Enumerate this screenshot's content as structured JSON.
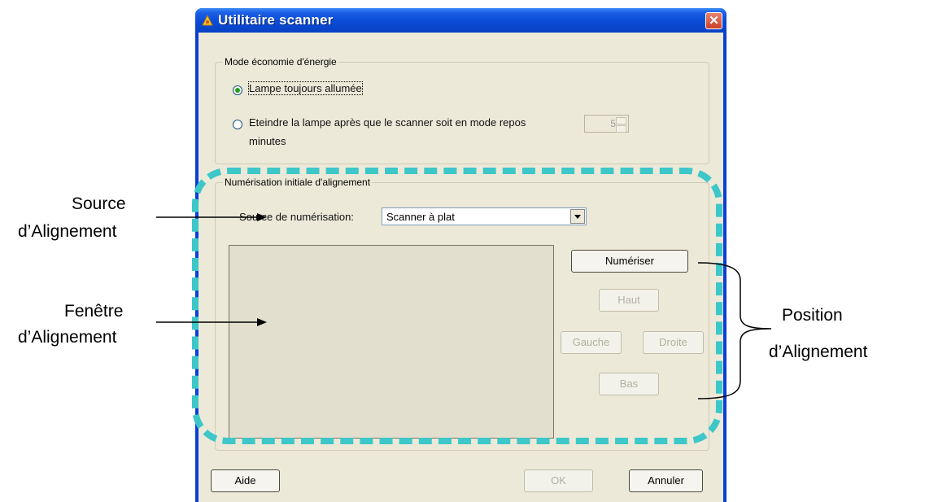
{
  "window": {
    "title": "Utilitaire scanner"
  },
  "power_group": {
    "label": "Mode économie d'énergie",
    "option_always_on": "Lampe toujours allumée",
    "option_turn_off": "Eteindre la lampe après que le scanner soit en mode repos",
    "option_turn_off_unit": "minutes",
    "repos_minutes": "5",
    "selected": "option_always_on"
  },
  "align_group": {
    "label": "Numérisation initiale d'alignement",
    "source_label": "Source de numérisation:",
    "source_value": "Scanner à plat",
    "buttons": {
      "scan": "Numériser",
      "up": "Haut",
      "left": "Gauche",
      "right": "Droite",
      "down": "Bas"
    }
  },
  "footer": {
    "help": "Aide",
    "ok": "OK",
    "cancel": "Annuler"
  },
  "annotations": {
    "source_line1": "Source",
    "source_line2": "d’Alignement",
    "window_line1": "Fenêtre",
    "window_line2": "d’Alignement",
    "position_line1": "Position",
    "position_line2": "d’Alignement"
  },
  "colors": {
    "titlebar": "#0a4bd6",
    "dialog_bg": "#ece9d8",
    "highlight": "#3dc7c9",
    "radio_dot": "#21a121"
  }
}
